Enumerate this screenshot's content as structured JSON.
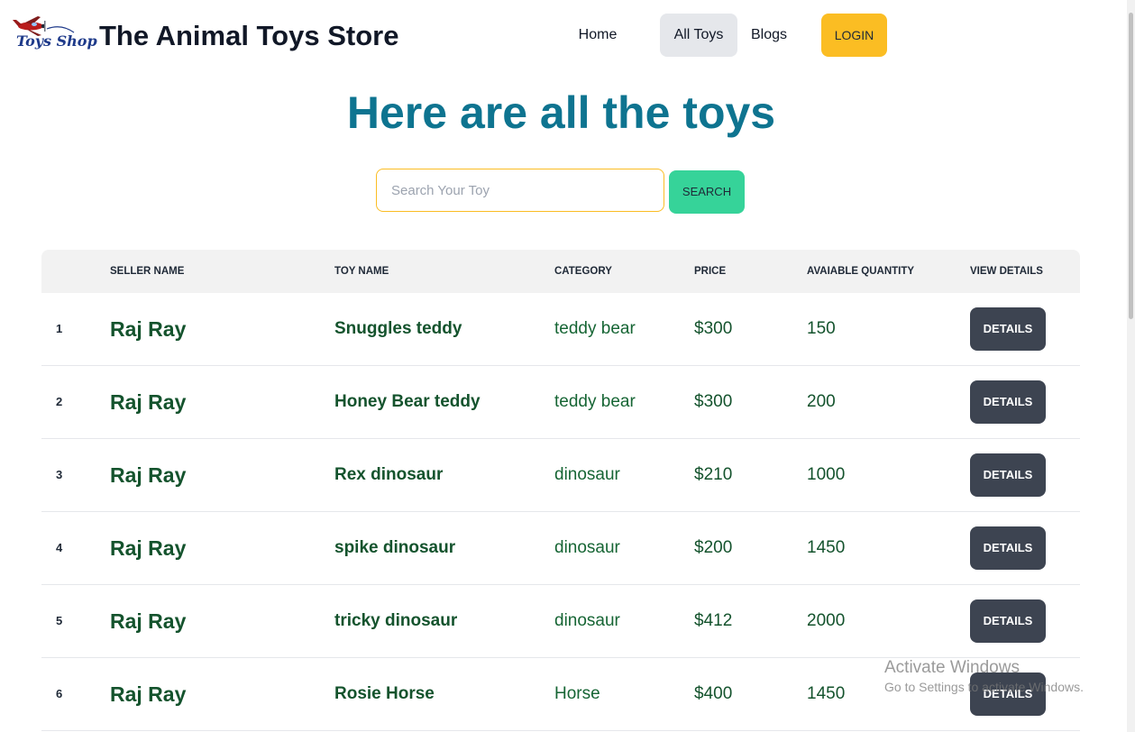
{
  "navbar": {
    "logo_text": "Toys Shop",
    "brand_title": "The Animal Toys Store",
    "links": [
      "Home",
      "All Toys",
      "Blogs"
    ],
    "login_label": "LOGIN"
  },
  "hero": {
    "title": "Here are all the toys"
  },
  "search": {
    "placeholder": "Search Your Toy",
    "value": "",
    "button_label": "SEARCH"
  },
  "table": {
    "headers": [
      "",
      "SELLER NAME",
      "TOY NAME",
      "CATEGORY",
      "PRICE",
      "AVAIABLE QUANTITY",
      "VIEW DETAILS"
    ],
    "rows": [
      {
        "index": "1",
        "seller": "Raj Ray",
        "toy": "Snuggles teddy",
        "category": "teddy bear",
        "price": "$300",
        "quantity": "150",
        "action": "DETAILS"
      },
      {
        "index": "2",
        "seller": "Raj Ray",
        "toy": "Honey Bear teddy",
        "category": "teddy bear",
        "price": "$300",
        "quantity": "200",
        "action": "DETAILS"
      },
      {
        "index": "3",
        "seller": "Raj Ray",
        "toy": "Rex dinosaur",
        "category": "dinosaur",
        "price": "$210",
        "quantity": "1000",
        "action": "DETAILS"
      },
      {
        "index": "4",
        "seller": "Raj Ray",
        "toy": "spike dinosaur",
        "category": "dinosaur",
        "price": "$200",
        "quantity": "1450",
        "action": "DETAILS"
      },
      {
        "index": "5",
        "seller": "Raj Ray",
        "toy": "tricky dinosaur",
        "category": "dinosaur",
        "price": "$412",
        "quantity": "2000",
        "action": "DETAILS"
      },
      {
        "index": "6",
        "seller": "Raj Ray",
        "toy": "Rosie Horse",
        "category": "Horse",
        "price": "$400",
        "quantity": "1450",
        "action": "DETAILS"
      }
    ]
  },
  "watermark": {
    "title": "Activate Windows",
    "subtitle": "Go to Settings to activate Windows."
  },
  "colors": {
    "brand_title": "#111827",
    "page_title": "#0e7490",
    "login_bg": "#fbbd23",
    "search_bg": "#36d399",
    "details_bg": "#3d4451",
    "row_text": "#14532d",
    "active_nav_bg": "#e5e7eb"
  },
  "icons": {
    "logo": "airplane-logo-icon"
  }
}
